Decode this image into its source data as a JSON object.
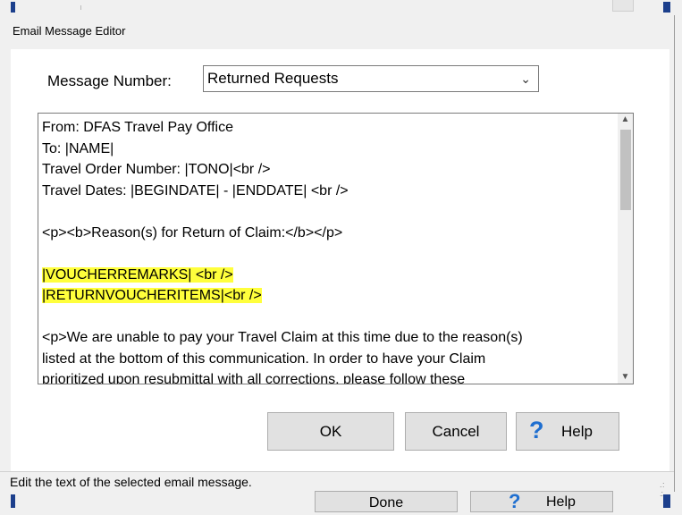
{
  "dialog": {
    "title": "Email Message Editor",
    "message_number_label": "Message Number:",
    "message_number_value": "Returned Requests",
    "message_lines": [
      "From: DFAS Travel Pay Office",
      "To: |NAME|",
      "Travel Order Number: |TONO|<br />",
      "Travel Dates: |BEGINDATE| - |ENDDATE| <br />",
      "",
      "<p><b>Reason(s) for Return of Claim:</b></p>",
      "",
      "|VOUCHERREMARKS| <br />",
      "|RETURNVOUCHERITEMS|<br />",
      "",
      "<p>We are unable to pay your Travel Claim at this time due to the reason(s)",
      "listed at the bottom of this communication. In order to have your Claim",
      "prioritized upon resubmittal with all corrections, please follow these"
    ],
    "highlighted_lines": [
      7,
      8
    ],
    "ok_label": "OK",
    "cancel_label": "Cancel",
    "help_label": "Help",
    "status_text": "Edit the text of the selected email message."
  },
  "background": {
    "done_label": "Done",
    "help_label": "Help"
  },
  "colors": {
    "highlight": "#ffff3c",
    "help_icon": "#1f6fd0",
    "dialog_bg": "#f0f0f0"
  }
}
